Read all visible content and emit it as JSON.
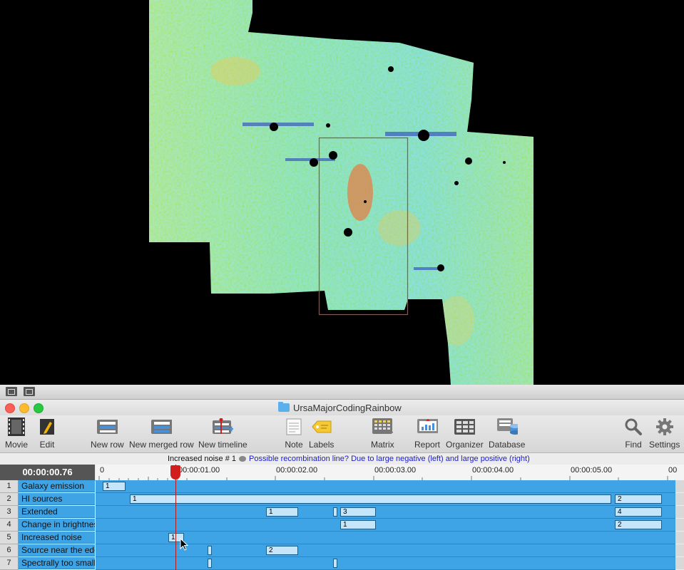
{
  "viewer": {
    "description_icon": "map-image"
  },
  "window": {
    "title": "UrsaMajorCodingRainbow"
  },
  "toolbar": {
    "items": [
      {
        "label": "Movie",
        "icon": "film-icon"
      },
      {
        "label": "Edit",
        "icon": "pencil-icon"
      },
      {
        "label": "New row",
        "icon": "new-row-icon"
      },
      {
        "label": "New merged row",
        "icon": "merged-row-icon"
      },
      {
        "label": "New timeline",
        "icon": "timeline-icon"
      },
      {
        "label": "Note",
        "icon": "note-icon"
      },
      {
        "label": "Labels",
        "icon": "tag-icon"
      },
      {
        "label": "Matrix",
        "icon": "matrix-icon"
      },
      {
        "label": "Report",
        "icon": "report-icon"
      },
      {
        "label": "Organizer",
        "icon": "organizer-icon"
      },
      {
        "label": "Database",
        "icon": "database-icon"
      },
      {
        "label": "Find",
        "icon": "search-icon"
      },
      {
        "label": "Settings",
        "icon": "gear-icon"
      }
    ]
  },
  "infobar": {
    "event_name": "Increased noise # 1",
    "note": "Possible recombination line?  Due to large negative (left) and large positive (right)"
  },
  "timeline": {
    "current_time": "00:00:00.76",
    "ticks": [
      "0",
      "00:00:01.00",
      "00:00:02.00",
      "00:00:03.00",
      "00:00:04.00",
      "00:00:05.00",
      "00"
    ],
    "rows": [
      {
        "num": "1",
        "name": "Galaxy emission",
        "cells": [
          {
            "label": "1"
          }
        ]
      },
      {
        "num": "2",
        "name": "HI sources",
        "cells": [
          {
            "label": "1"
          },
          {
            "label": "2"
          }
        ]
      },
      {
        "num": "3",
        "name": "Extended",
        "cells": [
          {
            "label": "1"
          },
          {
            "label": ""
          },
          {
            "label": "3"
          },
          {
            "label": "4"
          }
        ]
      },
      {
        "num": "4",
        "name": "Change in brightness",
        "cells": [
          {
            "label": "1"
          },
          {
            "label": "2"
          }
        ]
      },
      {
        "num": "5",
        "name": "Increased noise",
        "cells": [
          {
            "label": "1"
          }
        ]
      },
      {
        "num": "6",
        "name": "Source near the edge",
        "cells": [
          {
            "label": ""
          },
          {
            "label": "2"
          }
        ]
      },
      {
        "num": "7",
        "name": "Spectrally too small",
        "cells": [
          {
            "label": ""
          },
          {
            "label": ""
          }
        ]
      }
    ]
  }
}
